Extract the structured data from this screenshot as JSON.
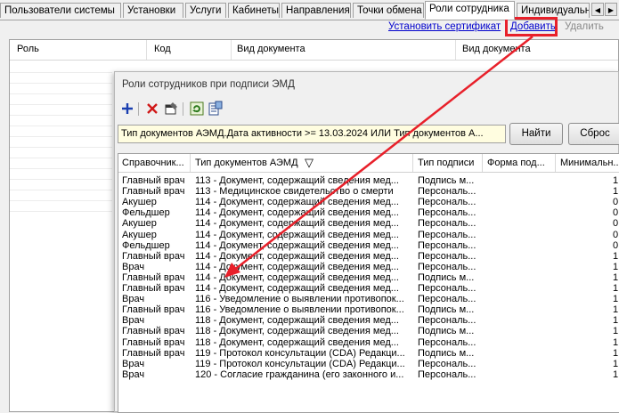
{
  "tabs": {
    "items": [
      {
        "label": "Пользователи системы"
      },
      {
        "label": "Установки"
      },
      {
        "label": "Услуги"
      },
      {
        "label": "Кабинеты"
      },
      {
        "label": "Направления"
      },
      {
        "label": "Точки обмена"
      },
      {
        "label": "Роли сотрудника",
        "active": true
      },
      {
        "label": "Индивидуальн"
      }
    ],
    "nav_left": "◀",
    "nav_right": "▶"
  },
  "actions": {
    "install_cert": "Установить сертификат",
    "add": "Добавить",
    "delete": "Удалить"
  },
  "back_grid": {
    "columns": [
      "Роль",
      "Код",
      "Вид документа",
      "Вид документа"
    ]
  },
  "dialog": {
    "title": "Роли сотрудников при подписи ЭМД",
    "toolbar": [
      "add-icon",
      "delete-icon",
      "properties-icon",
      "refresh-icon",
      "export-icon"
    ],
    "filter_text": "Тип документов АЭМД.Дата активности >= 13.03.2024 ИЛИ Тип документов А...",
    "find_button": "Найти",
    "reset_button": "Сброс",
    "columns": [
      "Справочник...",
      "Тип документов АЭМД",
      "Тип подписи",
      "Форма под...",
      "Минимальн..."
    ],
    "sort_indicator": "▽",
    "rows": [
      {
        "role": "Главный врач",
        "doc": "113 - Документ, содержащий сведения мед...",
        "sign": "Подпись м...",
        "form": "",
        "min": "1"
      },
      {
        "role": "Главный врач",
        "doc": "113 - Медицинское свидетельство о смерти",
        "sign": "Персональ...",
        "form": "",
        "min": "1"
      },
      {
        "role": "Акушер",
        "doc": "114 - Документ, содержащий сведения мед...",
        "sign": "Персональ...",
        "form": "",
        "min": "0"
      },
      {
        "role": "Фельдшер",
        "doc": "114 - Документ, содержащий сведения мед...",
        "sign": "Персональ...",
        "form": "",
        "min": "0"
      },
      {
        "role": "Акушер",
        "doc": "114 - Документ, содержащий сведения мед...",
        "sign": "Персональ...",
        "form": "",
        "min": "0"
      },
      {
        "role": "Акушер",
        "doc": "114 - Документ, содержащий сведения мед...",
        "sign": "Персональ...",
        "form": "",
        "min": "0"
      },
      {
        "role": "Фельдшер",
        "doc": "114 - Документ, содержащий сведения мед...",
        "sign": "Персональ...",
        "form": "",
        "min": "0"
      },
      {
        "role": "Главный врач",
        "doc": "114 - Документ, содержащий сведения мед...",
        "sign": "Персональ...",
        "form": "",
        "min": "1"
      },
      {
        "role": "Врач",
        "doc": "114 - Документ, содержащий сведения мед...",
        "sign": "Персональ...",
        "form": "",
        "min": "1"
      },
      {
        "role": "Главный врач",
        "doc": "114 - Документ, содержащий сведения мед...",
        "sign": "Подпись м...",
        "form": "",
        "min": "1"
      },
      {
        "role": "Главный врач",
        "doc": "114 - Документ, содержащий сведения мед...",
        "sign": "Персональ...",
        "form": "",
        "min": "1"
      },
      {
        "role": "Врач",
        "doc": "116 - Уведомление о выявлении противопок...",
        "sign": "Персональ...",
        "form": "",
        "min": "1"
      },
      {
        "role": "Главный врач",
        "doc": "116 - Уведомление о выявлении противопок...",
        "sign": "Подпись м...",
        "form": "",
        "min": "1"
      },
      {
        "role": "Врач",
        "doc": "118 - Документ, содержащий сведения мед...",
        "sign": "Персональ...",
        "form": "",
        "min": "1"
      },
      {
        "role": "Главный врач",
        "doc": "118 - Документ, содержащий сведения мед...",
        "sign": "Подпись м...",
        "form": "",
        "min": "1"
      },
      {
        "role": "Главный врач",
        "doc": "118 - Документ, содержащий сведения мед...",
        "sign": "Персональ...",
        "form": "",
        "min": "1"
      },
      {
        "role": "Главный врач",
        "doc": "119 - Протокол консультации (CDA) Редакци...",
        "sign": "Подпись м...",
        "form": "",
        "min": "1"
      },
      {
        "role": "Врач",
        "doc": "119 - Протокол консультации (CDA) Редакци...",
        "sign": "Персональ...",
        "form": "",
        "min": "1"
      },
      {
        "role": "Врач",
        "doc": "120 - Согласие гражданина (его законного и...",
        "sign": "Персональ...",
        "form": "",
        "min": "1"
      }
    ]
  },
  "colors": {
    "highlight": "#e8202a",
    "link": "#0000cc",
    "filter_bg": "#fffde0"
  }
}
